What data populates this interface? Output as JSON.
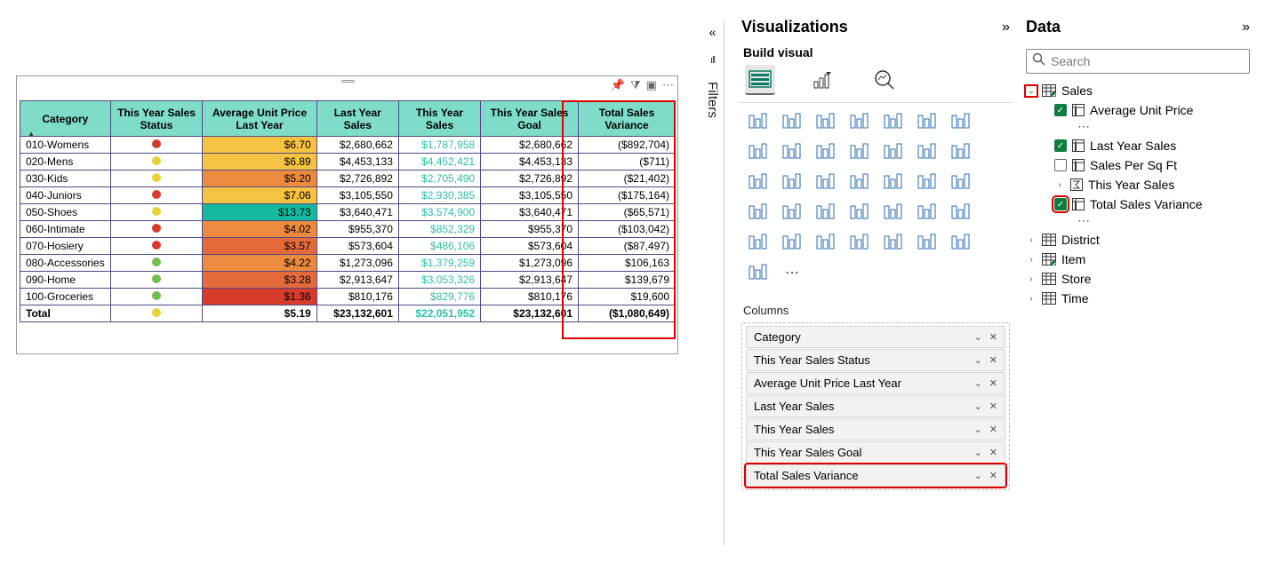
{
  "filters_label": "Filters",
  "visualizations": {
    "title": "Visualizations",
    "subtitle": "Build visual",
    "columns_label": "Columns",
    "wells": [
      {
        "label": "Category",
        "hl": false
      },
      {
        "label": "This Year Sales Status",
        "hl": false
      },
      {
        "label": "Average Unit Price Last Year",
        "hl": false
      },
      {
        "label": "Last Year Sales",
        "hl": false
      },
      {
        "label": "This Year Sales",
        "hl": false
      },
      {
        "label": "This Year Sales Goal",
        "hl": false
      },
      {
        "label": "Total Sales Variance",
        "hl": true
      }
    ]
  },
  "data": {
    "title": "Data",
    "search_placeholder": "Search",
    "tables": [
      {
        "name": "Sales",
        "expanded": true,
        "hl_chevron": true,
        "fields": [
          {
            "name": "Average Unit Price",
            "checked": true,
            "type": "column",
            "ellipsis": true
          },
          {
            "name": "Last Year Sales",
            "checked": true,
            "type": "column"
          },
          {
            "name": "Sales Per Sq Ft",
            "checked": false,
            "type": "column"
          },
          {
            "name": "This Year Sales",
            "checked": null,
            "type": "sigma",
            "chevron": true
          },
          {
            "name": "Total Sales Variance",
            "checked": true,
            "type": "column",
            "hl": true,
            "ellipsis": true
          }
        ]
      },
      {
        "name": "District",
        "expanded": false
      },
      {
        "name": "Item",
        "expanded": false,
        "badge": true
      },
      {
        "name": "Store",
        "expanded": false
      },
      {
        "name": "Time",
        "expanded": false
      }
    ]
  },
  "chart_data": {
    "type": "table",
    "columns": [
      "Category",
      "This Year Sales Status",
      "Average Unit Price Last Year",
      "Last Year Sales",
      "This Year Sales",
      "This Year Sales Goal",
      "Total Sales Variance"
    ],
    "rows": [
      {
        "cat": "010-Womens",
        "status": "#d73b2c",
        "avg": "$6.70",
        "avg_bg": "#f5c242",
        "lys": "$2,680,662",
        "tys": "$1,787,958",
        "tys_c": "#2fbfa7",
        "goal": "$2,680,662",
        "var": "($892,704)"
      },
      {
        "cat": "020-Mens",
        "status": "#e8d23a",
        "avg": "$6.89",
        "avg_bg": "#f5c242",
        "lys": "$4,453,133",
        "tys": "$4,452,421",
        "tys_c": "#2fbfa7",
        "goal": "$4,453,133",
        "var": "($711)"
      },
      {
        "cat": "030-Kids",
        "status": "#e8d23a",
        "avg": "$5.20",
        "avg_bg": "#ec8b3f",
        "lys": "$2,726,892",
        "tys": "$2,705,490",
        "tys_c": "#2fbfa7",
        "goal": "$2,726,892",
        "var": "($21,402)"
      },
      {
        "cat": "040-Juniors",
        "status": "#d73b2c",
        "avg": "$7.06",
        "avg_bg": "#f5c242",
        "lys": "$3,105,550",
        "tys": "$2,930,385",
        "tys_c": "#2fbfa7",
        "goal": "$3,105,550",
        "var": "($175,164)"
      },
      {
        "cat": "050-Shoes",
        "status": "#e8d23a",
        "avg": "$13.73",
        "avg_bg": "#14b8a0",
        "lys": "$3,640,471",
        "tys": "$3,574,900",
        "tys_c": "#2fbfa7",
        "goal": "$3,640,471",
        "var": "($65,571)"
      },
      {
        "cat": "060-Intimate",
        "status": "#d73b2c",
        "avg": "$4.02",
        "avg_bg": "#ec8b3f",
        "lys": "$955,370",
        "tys": "$852,329",
        "tys_c": "#2fbfa7",
        "goal": "$955,370",
        "var": "($103,042)"
      },
      {
        "cat": "070-Hosiery",
        "status": "#d73b2c",
        "avg": "$3.57",
        "avg_bg": "#e46a3a",
        "lys": "$573,604",
        "tys": "$486,106",
        "tys_c": "#2fbfa7",
        "goal": "$573,604",
        "var": "($87,497)"
      },
      {
        "cat": "080-Accessories",
        "status": "#6fbf4b",
        "avg": "$4.22",
        "avg_bg": "#ec8b3f",
        "lys": "$1,273,096",
        "tys": "$1,379,259",
        "tys_c": "#2fbfa7",
        "goal": "$1,273,096",
        "var": "$106,163"
      },
      {
        "cat": "090-Home",
        "status": "#6fbf4b",
        "avg": "$3.28",
        "avg_bg": "#e46a3a",
        "lys": "$2,913,647",
        "tys": "$3,053,326",
        "tys_c": "#2fbfa7",
        "goal": "$2,913,647",
        "var": "$139,679"
      },
      {
        "cat": "100-Groceries",
        "status": "#6fbf4b",
        "avg": "$1.36",
        "avg_bg": "#d73b2c",
        "lys": "$810,176",
        "tys": "$829,776",
        "tys_c": "#2fbfa7",
        "goal": "$810,176",
        "var": "$19,600"
      }
    ],
    "total": {
      "cat": "Total",
      "status": "#e8d23a",
      "avg": "$5.19",
      "lys": "$23,132,601",
      "tys": "$22,051,952",
      "tys_c": "#2fbfa7",
      "goal": "$23,132,601",
      "var": "($1,080,649)"
    }
  }
}
